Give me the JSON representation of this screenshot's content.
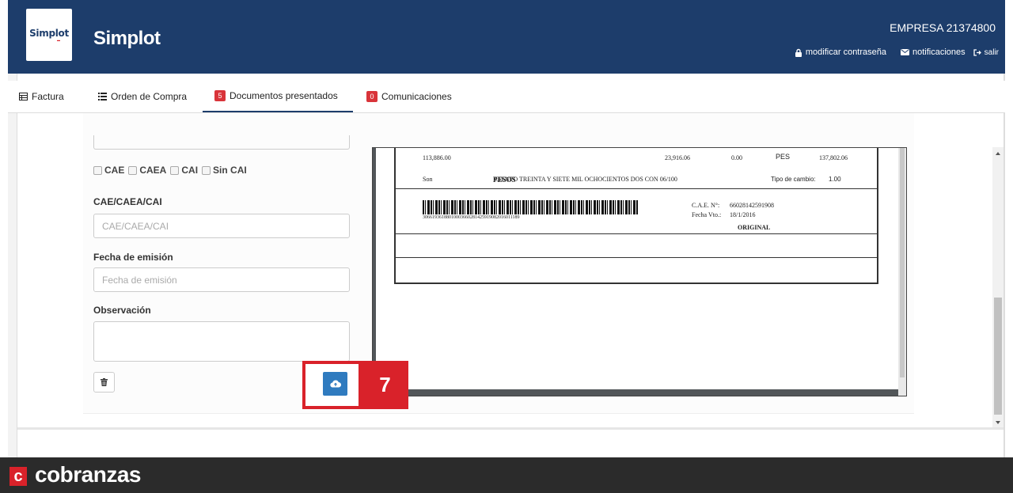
{
  "header": {
    "logo_text": "Simplot",
    "brand": "Simplot",
    "company": "EMPRESA 21374800",
    "links": {
      "change_password": "modificar contraseña",
      "notifications": "notificaciones",
      "logout": "salir"
    }
  },
  "tabs": [
    {
      "label": "Factura",
      "icon": "table-icon"
    },
    {
      "label": "Orden de Compra",
      "icon": "list-icon"
    },
    {
      "label": "Documentos presentados",
      "badge": "5",
      "active": true
    },
    {
      "label": "Comunicaciones",
      "badge": "0"
    }
  ],
  "form": {
    "checkboxes": [
      "CAE",
      "CAEA",
      "CAI",
      "Sin CAI"
    ],
    "cae_label": "CAE/CAEA/CAI",
    "cae_placeholder": "CAE/CAEA/CAI",
    "date_label": "Fecha de emisión",
    "date_placeholder": "Fecha de emisión",
    "obs_label": "Observación"
  },
  "step_badge": "7",
  "document": {
    "net": "113,886.00",
    "iva": "23,916.06",
    "other": "0.00",
    "currency": "PES",
    "total": "137,802.06",
    "son_label": "Son",
    "amount_words": "CIENTO TREINTA Y SIETE MIL OCHOCIENTOS DOS CON 06/100",
    "overprint": "PESOS",
    "exchange_label": "Tipo de cambio:",
    "exchange_value": "1.00",
    "barcode_number": "30661936188010003660281425919082016011189",
    "cae_label": "C.A.E. N°:",
    "cae_value": "66028142591908",
    "due_label": "Fecha Vto.:",
    "due_value": "18/1/2016",
    "copy": "ORIGINAL"
  },
  "footer": {
    "logo_letter": "c",
    "brand": "cobranzas"
  },
  "colors": {
    "header_bg": "#1d3d6b",
    "accent_red": "#d9222a",
    "upload_blue": "#2f7bbf",
    "footer_bg": "#2b2b2b"
  }
}
